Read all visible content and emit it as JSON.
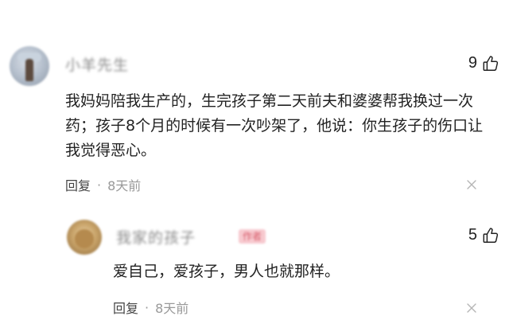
{
  "comments": [
    {
      "username": "小羊先生",
      "likes": "9",
      "text": "我妈妈陪我生产的，生完孩子第二天前夫和婆婆帮我换过一次药；孩子8个月的时候有一次吵架了，他说：你生孩子的伤口让我觉得恶心。",
      "reply_label": "回复",
      "separator": "·",
      "time": "8天前",
      "icons": {
        "avatar": "avatar",
        "like": "thumbs-up-icon",
        "close": "close-icon"
      }
    }
  ],
  "reply": {
    "username": "我家的孩子",
    "badge": "作者",
    "likes": "5",
    "text": "爱自己，爱孩子，男人也就那样。",
    "reply_label": "回复",
    "separator": "·",
    "time": "8天前"
  },
  "colors": {
    "text": "#222222",
    "meta": "#999999",
    "badge_bg": "#f7c9cf",
    "badge_text": "#d8606e"
  }
}
